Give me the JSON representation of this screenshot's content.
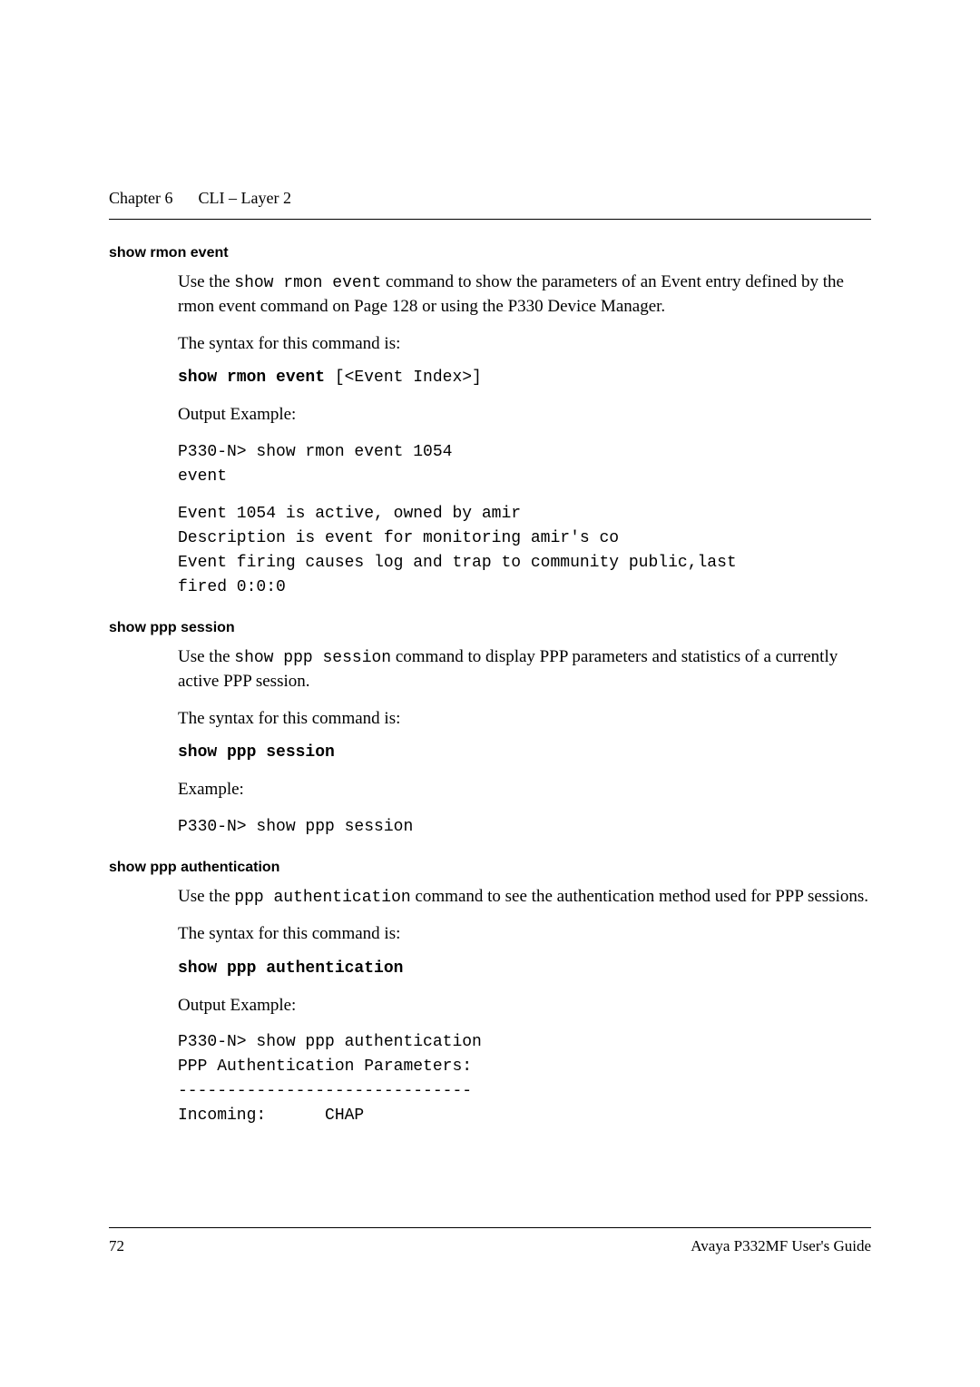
{
  "header": {
    "chapter_label": "Chapter 6",
    "chapter_title": "CLI – Layer 2"
  },
  "sections": {
    "rmon": {
      "heading": "show rmon event",
      "para1_prefix": "Use the ",
      "para1_cmd": "show rmon event",
      "para1_suffix": " command to show the parameters of an Event entry defined by the rmon event command on Page 128 or using the P330 Device Manager.",
      "syntax_intro": "The syntax for this command is:",
      "syntax_bold": "show rmon event",
      "syntax_rest": " [<Event Index>]",
      "output_label": "Output Example:",
      "output_block1": "P330-N> show rmon event 1054\nevent",
      "output_block2": "Event 1054 is active, owned by amir\nDescription is event for monitoring amir's co\nEvent firing causes log and trap to community public,last\nfired 0:0:0"
    },
    "ppp_session": {
      "heading": "show ppp session",
      "para1_prefix": "Use the ",
      "para1_cmd": "show ppp session",
      "para1_suffix": " command to display PPP parameters and statistics of a currently active PPP session.",
      "syntax_intro": "The syntax for this command is:",
      "syntax_bold": "show ppp session",
      "example_label": "Example:",
      "example_block": "P330-N> show ppp session"
    },
    "ppp_auth": {
      "heading": "show ppp authentication",
      "para1_prefix": "Use the ",
      "para1_cmd": "ppp authentication",
      "para1_suffix": " command to see the authentication method used for PPP sessions.",
      "syntax_intro": "The syntax for this command is:",
      "syntax_bold": "show ppp authentication",
      "output_label": "Output Example:",
      "output_block": "P330-N> show ppp authentication\nPPP Authentication Parameters:\n------------------------------\nIncoming:      CHAP"
    }
  },
  "footer": {
    "page_number": "72",
    "guide": "Avaya P332MF User's Guide"
  }
}
